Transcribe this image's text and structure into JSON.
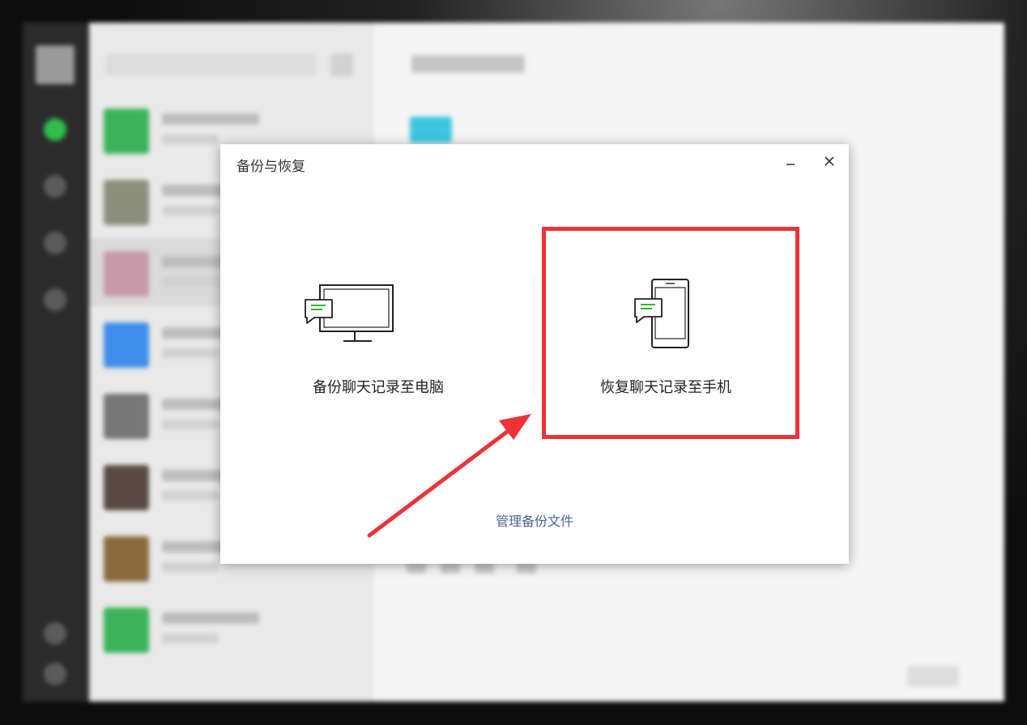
{
  "dialog": {
    "title": "备份与恢复",
    "options": [
      {
        "label": "备份聊天记录至电脑",
        "icon": "monitor-chat-icon"
      },
      {
        "label": "恢复聊天记录至手机",
        "icon": "phone-chat-icon"
      }
    ],
    "manage_link": "管理备份文件"
  },
  "colors": {
    "accent_green": "#1aad19",
    "annotation_red": "#ef3237",
    "link_blue": "#4a6592"
  }
}
